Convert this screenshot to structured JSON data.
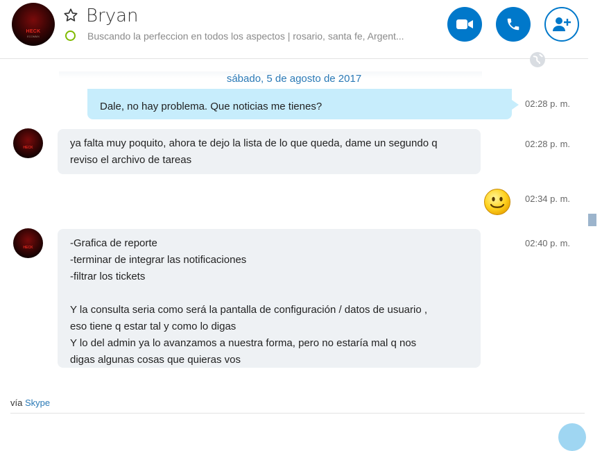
{
  "header": {
    "name": "Bryan",
    "mood": "Buscando la perfeccion en todos los aspectos  |  rosario, santa fe, Argent...",
    "avatar_brand": "HECK",
    "avatar_sub": "ECOMMX",
    "status_color": "#7fba00",
    "buttons": [
      {
        "icon": "video-camera-icon",
        "label": "video call"
      },
      {
        "icon": "phone-icon",
        "label": "audio call"
      },
      {
        "icon": "add-person-icon",
        "label": "add people"
      }
    ]
  },
  "conversation": {
    "date": "sábado, 5 de agosto de 2017",
    "messages": [
      {
        "direction": "out",
        "lines": [
          "Dale, no hay problema. Que noticias me tienes?"
        ],
        "time": "02:28 p. m."
      },
      {
        "direction": "in",
        "lines": [
          "ya falta muy poquito, ahora te dejo la lista de lo que queda, dame un segundo q",
          "reviso el archivo de tareas"
        ],
        "time": "02:28 p. m."
      },
      {
        "direction": "out",
        "emoji": "smile-emoji-icon",
        "time": "02:34 p. m."
      },
      {
        "direction": "in",
        "lines": [
          "-Grafica de reporte",
          "-terminar de integrar las notificaciones",
          "-filtrar los tickets",
          "",
          "Y la consulta seria como será la pantalla de configuración / datos de usuario ,",
          "eso tiene q estar tal y como lo digas",
          "Y lo del admin ya lo avanzamos a nuestra forma, pero no estaría mal q nos",
          "digas algunas cosas que quieras vos"
        ],
        "time": "02:40 p. m."
      }
    ]
  },
  "footer": {
    "via_prefix": "vía",
    "via_link": "Skype"
  },
  "colors": {
    "accent": "#0078ca",
    "outgoing_bubble": "#c7edfc",
    "incoming_bubble": "#eef1f4",
    "date_text": "#2a79b6"
  }
}
